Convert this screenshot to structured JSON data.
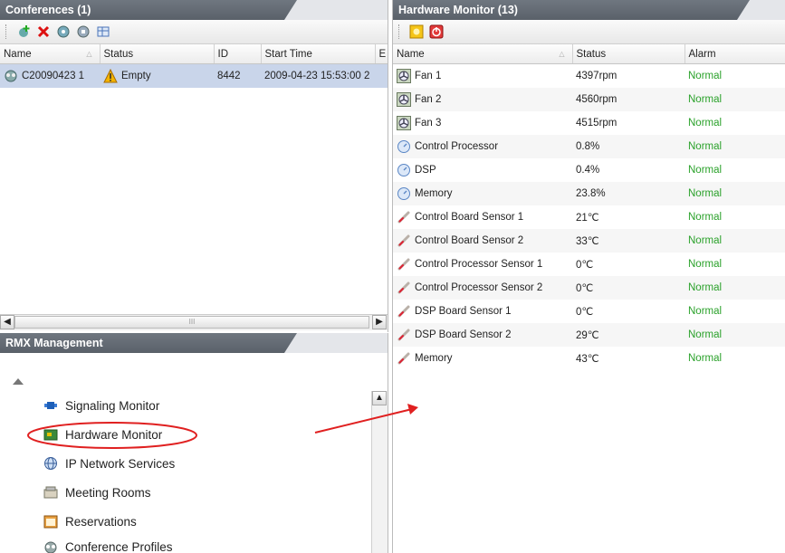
{
  "conferences": {
    "title": "Conferences (1)",
    "columns": [
      "Name",
      "Status",
      "ID",
      "Start Time",
      "E"
    ],
    "rows": [
      {
        "name": "C20090423 1",
        "status": "Empty",
        "id": "8442",
        "start_time": "2009-04-23 15:53:00 2"
      }
    ],
    "scroll_grip": "III"
  },
  "rmx": {
    "title": "RMX Management",
    "items": [
      {
        "label": "Signaling Monitor",
        "icon": "signaling-icon"
      },
      {
        "label": "Hardware Monitor",
        "icon": "hardware-icon"
      },
      {
        "label": "IP Network Services",
        "icon": "globe-icon"
      },
      {
        "label": "Meeting Rooms",
        "icon": "meeting-rooms-icon"
      },
      {
        "label": "Reservations",
        "icon": "reservations-icon"
      },
      {
        "label": "Conference Profiles",
        "icon": "conference-profiles-icon"
      }
    ]
  },
  "hardware": {
    "title": "Hardware Monitor (13)",
    "columns": [
      "Name",
      "Status",
      "Alarm"
    ],
    "rows": [
      {
        "name": "Fan 1",
        "status": "4397rpm",
        "alarm": "Normal",
        "type": "fan"
      },
      {
        "name": "Fan 2",
        "status": "4560rpm",
        "alarm": "Normal",
        "type": "fan"
      },
      {
        "name": "Fan 3",
        "status": "4515rpm",
        "alarm": "Normal",
        "type": "fan"
      },
      {
        "name": "Control Processor",
        "status": "0.8%",
        "alarm": "Normal",
        "type": "gauge"
      },
      {
        "name": "DSP",
        "status": "0.4%",
        "alarm": "Normal",
        "type": "gauge"
      },
      {
        "name": "Memory",
        "status": "23.8%",
        "alarm": "Normal",
        "type": "gauge"
      },
      {
        "name": "Control Board Sensor 1",
        "status": "21℃",
        "alarm": "Normal",
        "type": "thermo"
      },
      {
        "name": "Control Board Sensor 2",
        "status": "33℃",
        "alarm": "Normal",
        "type": "thermo"
      },
      {
        "name": "Control Processor Sensor 1",
        "status": "0℃",
        "alarm": "Normal",
        "type": "thermo"
      },
      {
        "name": "Control Processor Sensor 2",
        "status": "0℃",
        "alarm": "Normal",
        "type": "thermo"
      },
      {
        "name": "DSP Board Sensor 1",
        "status": "0℃",
        "alarm": "Normal",
        "type": "thermo"
      },
      {
        "name": "DSP Board Sensor 2",
        "status": "29℃",
        "alarm": "Normal",
        "type": "thermo"
      },
      {
        "name": "Memory",
        "status": "43℃",
        "alarm": "Normal",
        "type": "thermo"
      }
    ]
  },
  "colors": {
    "alarm_normal": "#2aa12a",
    "highlight_row": "#c9d5ea",
    "annotation_red": "#e02020"
  }
}
